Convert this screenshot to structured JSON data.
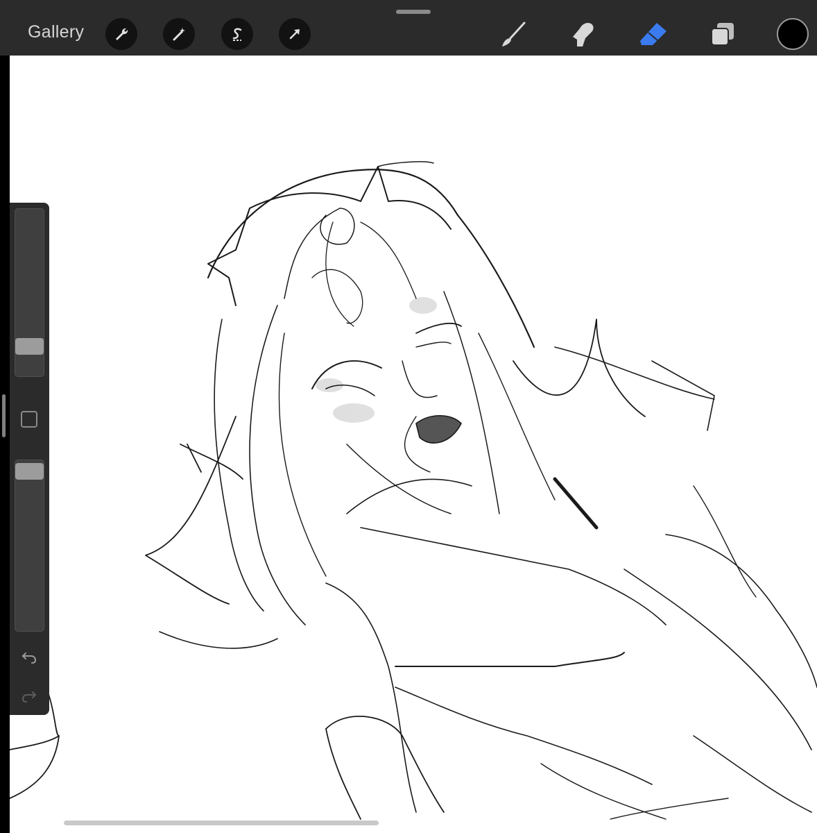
{
  "app": {
    "gallery_label": "Gallery"
  },
  "toolbar": {
    "left_tools": [
      {
        "name": "actions-wrench-icon"
      },
      {
        "name": "adjustments-magic-wand-icon"
      },
      {
        "name": "selection-s-icon"
      },
      {
        "name": "transform-arrow-icon"
      }
    ],
    "right_tools": [
      {
        "name": "brush-icon"
      },
      {
        "name": "smudge-icon"
      },
      {
        "name": "eraser-icon",
        "active": true
      },
      {
        "name": "layers-icon"
      }
    ],
    "current_color": "#000000",
    "active_color": "#3a7cf0"
  },
  "side_panel": {
    "brush_size_level": 0.2,
    "opacity_level": 1.0,
    "undo_icon": "undo-icon",
    "redo_icon": "redo-icon"
  }
}
